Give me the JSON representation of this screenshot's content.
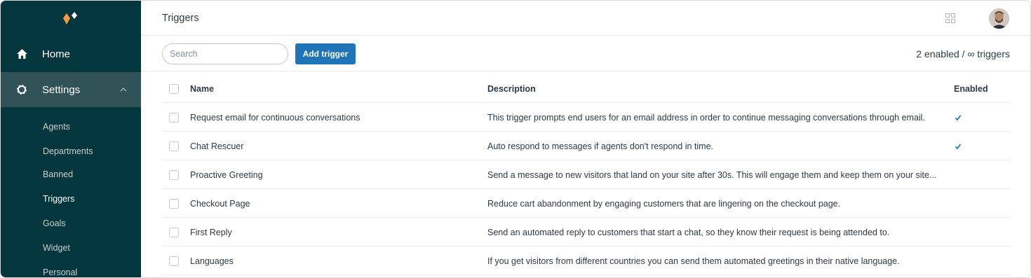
{
  "app": {
    "page_title": "Triggers",
    "accent_color": "#1f73b7",
    "sidebar_bg": "#03363d"
  },
  "sidebar": {
    "home_label": "Home",
    "settings_label": "Settings",
    "sub_items": [
      "Agents",
      "Departments",
      "Banned",
      "Triggers",
      "Goals",
      "Widget",
      "Personal"
    ],
    "active_sub_item": "Triggers"
  },
  "toolbar": {
    "search_placeholder": "Search",
    "add_label": "Add trigger",
    "count_text": "2 enabled / ∞ triggers"
  },
  "table": {
    "headers": {
      "name": "Name",
      "description": "Description",
      "enabled": "Enabled"
    },
    "rows": [
      {
        "name": "Request email for continuous conversations",
        "description": "This trigger prompts end users for an email address in order to continue messaging conversations through email.",
        "enabled": true
      },
      {
        "name": "Chat Rescuer",
        "description": "Auto respond to messages if agents don't respond in time.",
        "enabled": true
      },
      {
        "name": "Proactive Greeting",
        "description": "Send a message to new visitors that land on your site after 30s. This will engage them and keep them on your site...",
        "enabled": false
      },
      {
        "name": "Checkout Page",
        "description": "Reduce cart abandonment by engaging customers that are lingering on the checkout page.",
        "enabled": false
      },
      {
        "name": "First Reply",
        "description": "Send an automated reply to customers that start a chat, so they know their request is being attended to.",
        "enabled": false
      },
      {
        "name": "Languages",
        "description": "If you get visitors from different countries you can send them automated greetings in their native language.",
        "enabled": false
      }
    ]
  },
  "icons": {
    "home": "home-icon",
    "settings": "gear-icon",
    "chevron": "chevron-up-icon",
    "apps": "grid-icon",
    "check": "check-icon"
  }
}
